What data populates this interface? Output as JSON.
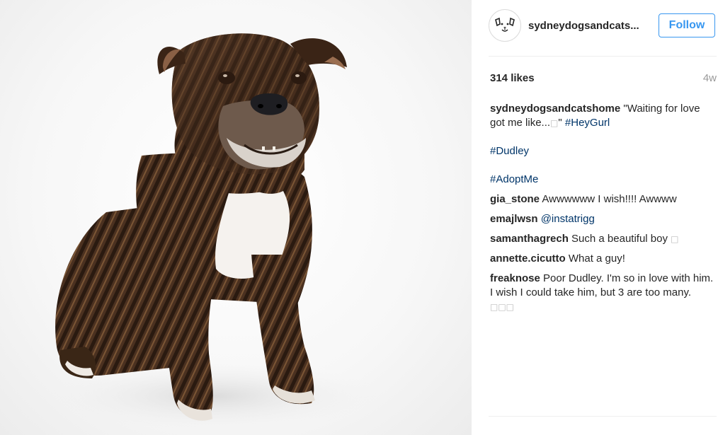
{
  "post": {
    "username": "sydneydogsandcats...",
    "follow_label": "Follow",
    "likes": "314 likes",
    "time_ago": "4w"
  },
  "caption": {
    "author": "sydneydogsandcatshome",
    "text": "\"Waiting for love got me like...",
    "end_glyph": "□",
    "end_quote": "\"",
    "hashtags": [
      "#HeyGurl",
      "#Dudley",
      "#AdoptMe"
    ]
  },
  "comments": [
    {
      "author": "gia_stone",
      "text": "Awwwwww I wish!!!! Awwww"
    },
    {
      "author": "emajlwsn",
      "mention": "@instatrigg"
    },
    {
      "author": "samanthagrech",
      "text": "Such a beautiful boy",
      "glyph": "□"
    },
    {
      "author": "annette.cicutto",
      "text": "What a guy!"
    },
    {
      "author": "freaknose",
      "text": "Poor Dudley. I'm so in love with him. I wish I could take him, but 3 are too many.",
      "glyph": "□□□"
    }
  ],
  "colors": {
    "accent": "#3897f0",
    "hashtag": "#003569",
    "muted": "#999999",
    "text": "#262626"
  },
  "icons": {
    "avatar": "dog-face-logo-icon"
  }
}
